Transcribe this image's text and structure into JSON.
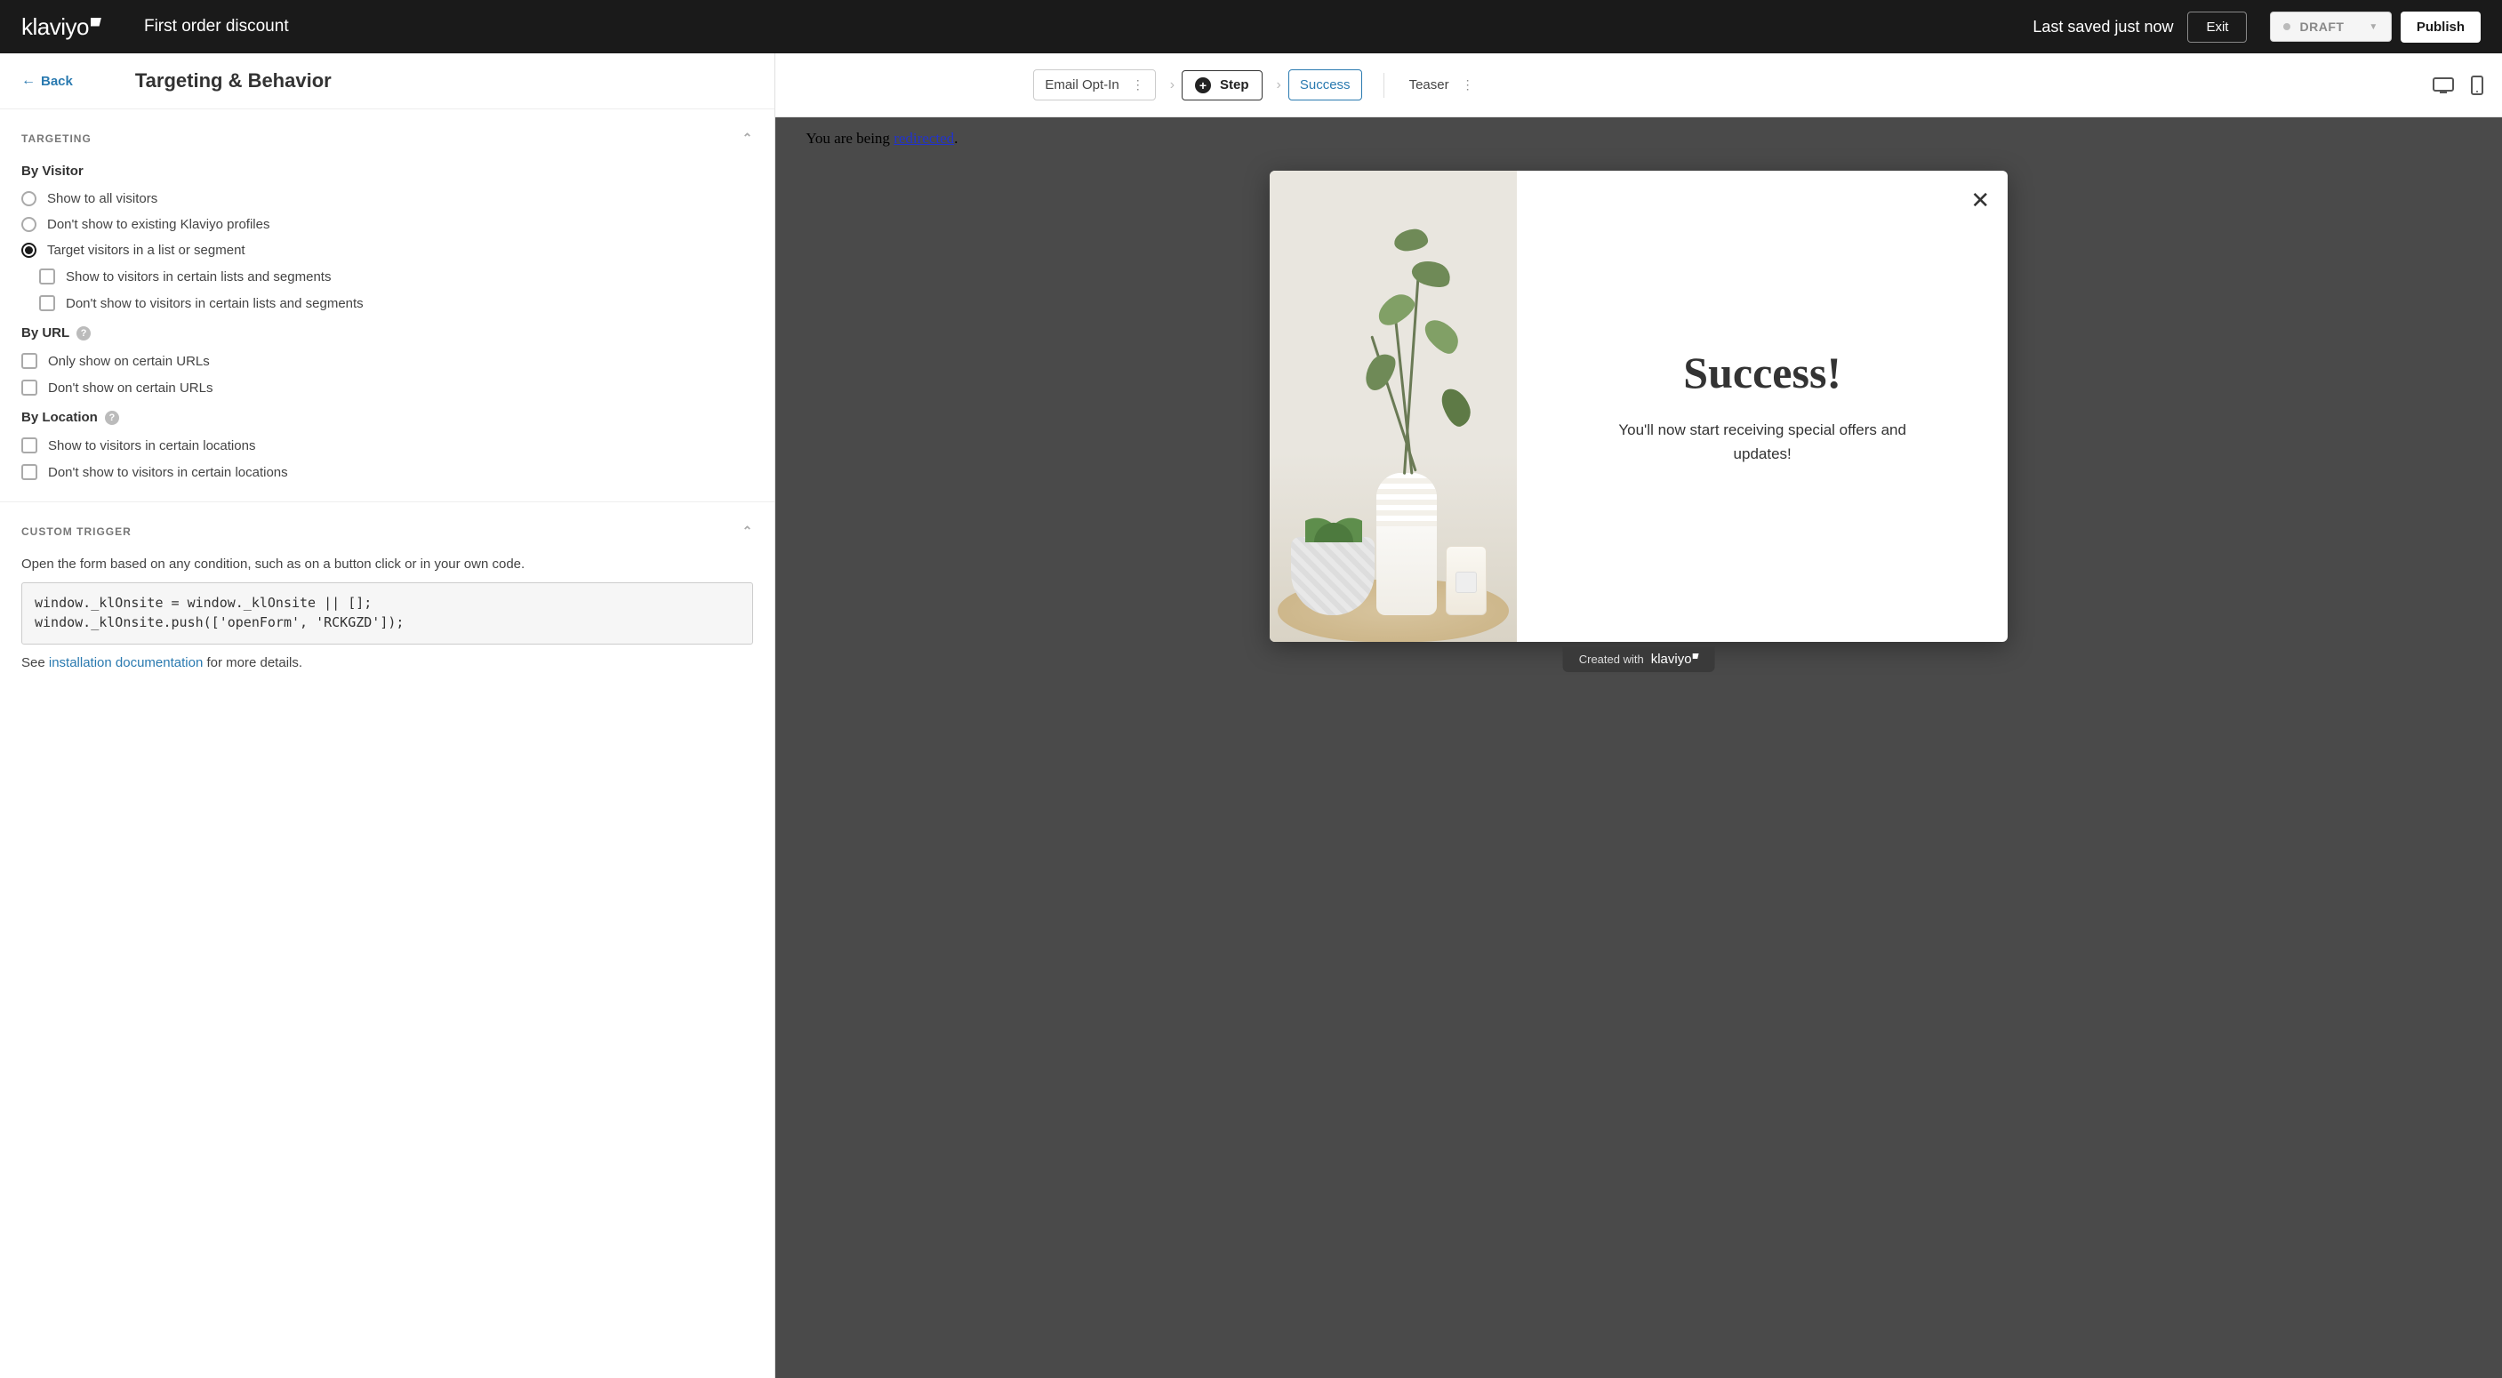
{
  "header": {
    "brand": "klaviyo",
    "title": "First order discount",
    "last_saved": "Last saved just now",
    "exit": "Exit",
    "status": "DRAFT",
    "publish": "Publish"
  },
  "sidebar": {
    "back": "Back",
    "panel_title": "Targeting & Behavior",
    "targeting_section": "TARGETING",
    "by_visitor_label": "By Visitor",
    "visitor_options": {
      "all": "Show to all visitors",
      "no_existing": "Don't show to existing Klaviyo profiles",
      "target_list": "Target visitors in a list or segment",
      "show_certain": "Show to visitors in certain lists and segments",
      "hide_certain": "Don't show to visitors in certain lists and segments"
    },
    "by_url_label": "By URL",
    "url_options": {
      "only": "Only show on certain URLs",
      "hide": "Don't show on certain URLs"
    },
    "by_location_label": "By Location",
    "location_options": {
      "show": "Show to visitors in certain locations",
      "hide": "Don't show to visitors in certain locations"
    },
    "custom_trigger_section": "CUSTOM TRIGGER",
    "custom_trigger_desc": "Open the form based on any condition, such as on a button click or in your own code.",
    "custom_trigger_code": "window._klOnsite = window._klOnsite || [];\nwindow._klOnsite.push(['openForm', 'RCKGZD']);",
    "doc_prefix": "See ",
    "doc_link": "installation documentation",
    "doc_suffix": " for more details."
  },
  "steps": {
    "email_optin": "Email Opt-In",
    "add_step": "Step",
    "success": "Success",
    "teaser": "Teaser"
  },
  "preview": {
    "redirect_prefix": "You are being ",
    "redirect_link": "redirected",
    "redirect_suffix": ".",
    "popup_title": "Success!",
    "popup_sub": "You'll now start receiving special offers and updates!",
    "credit_prefix": "Created with",
    "credit_brand": "klaviyo"
  }
}
